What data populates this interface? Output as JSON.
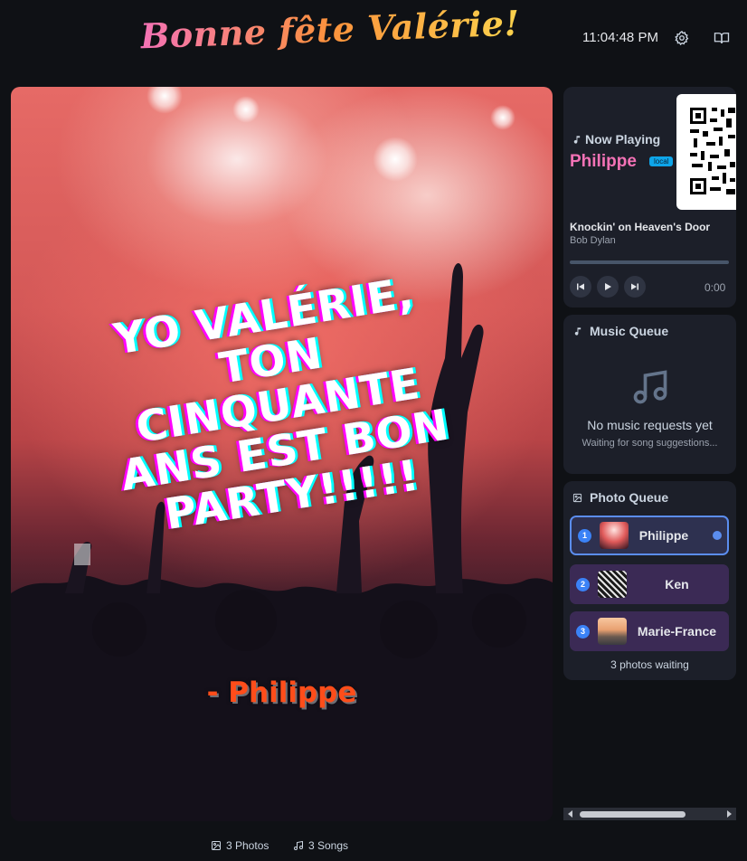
{
  "header": {
    "title": "Bonne fête Valérie!",
    "clock": "11:04:48 PM",
    "icons": [
      "gear-icon",
      "book-open-icon"
    ]
  },
  "slide": {
    "message_lines": [
      "YO VALÉRIE,",
      "TON",
      "CINQUANTE",
      "ANS EST BON",
      "PARTY!!!!!"
    ],
    "author": "- Philippe"
  },
  "footer": {
    "photos": "3 Photos",
    "songs": "3 Songs"
  },
  "now_playing": {
    "label": "Now Playing",
    "requester": "Philippe",
    "badge": "local",
    "song": "Knockin' on Heaven's Door",
    "artist": "Bob Dylan",
    "time": "0:00",
    "progress": 0
  },
  "music_queue": {
    "title": "Music Queue",
    "empty": "No music requests yet",
    "sub": "Waiting for song suggestions..."
  },
  "photo_queue": {
    "title": "Photo Queue",
    "items": [
      {
        "num": "1",
        "name": "Philippe"
      },
      {
        "num": "2",
        "name": "Ken"
      },
      {
        "num": "3",
        "name": "Marie-France"
      }
    ],
    "count": "3 photos waiting"
  },
  "colors": {
    "accent": "#f472b6",
    "badge": "#0ea5e9",
    "queue_item": "#3b2a55",
    "number_badge": "#3b82f6"
  }
}
